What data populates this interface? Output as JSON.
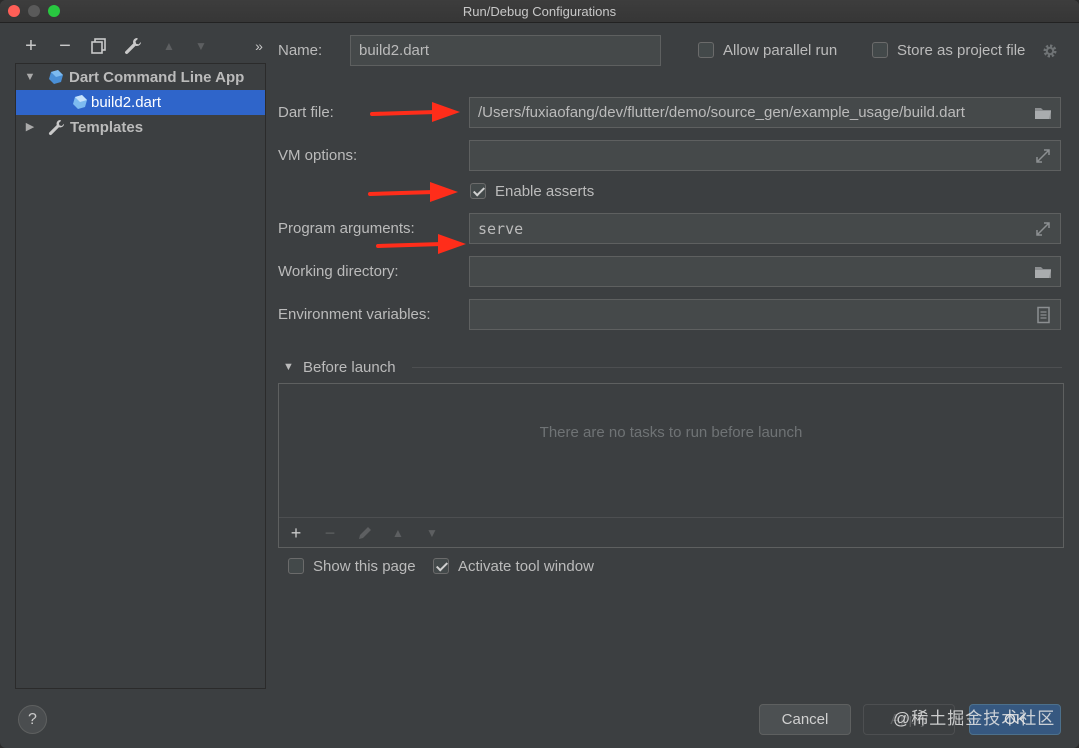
{
  "window": {
    "title": "Run/Debug Configurations"
  },
  "toolbar": {
    "add": "+",
    "remove": "−",
    "more": "»"
  },
  "tree": {
    "group_label": "Dart Command Line App",
    "selected_item": "build2.dart",
    "templates_label": "Templates"
  },
  "form": {
    "name_label": "Name:",
    "name_value": "build2.dart",
    "allow_parallel_label": "Allow parallel run",
    "store_project_label": "Store as project file",
    "dart_file_label": "Dart file:",
    "dart_file_value": "/Users/fuxiaofang/dev/flutter/demo/source_gen/example_usage/build.dart",
    "vm_options_label": "VM options:",
    "vm_options_value": "",
    "enable_asserts_label": "Enable asserts",
    "program_args_label": "Program arguments:",
    "program_args_value": "serve",
    "working_dir_label": "Working directory:",
    "working_dir_value": "",
    "env_vars_label": "Environment variables:",
    "env_vars_value": ""
  },
  "before_launch": {
    "title": "Before launch",
    "empty_text": "There are no tasks to run before launch",
    "add": "+",
    "remove": "−"
  },
  "footer_checks": {
    "show_page_label": "Show this page",
    "activate_tool_label": "Activate tool window"
  },
  "buttons": {
    "help": "?",
    "cancel": "Cancel",
    "apply": "Apply",
    "ok": "OK"
  },
  "watermark": "@稀土掘金技术社区",
  "colors": {
    "selection": "#2f65ca",
    "annotation_arrow": "#ff2d1a",
    "ok_button": "#365880"
  }
}
